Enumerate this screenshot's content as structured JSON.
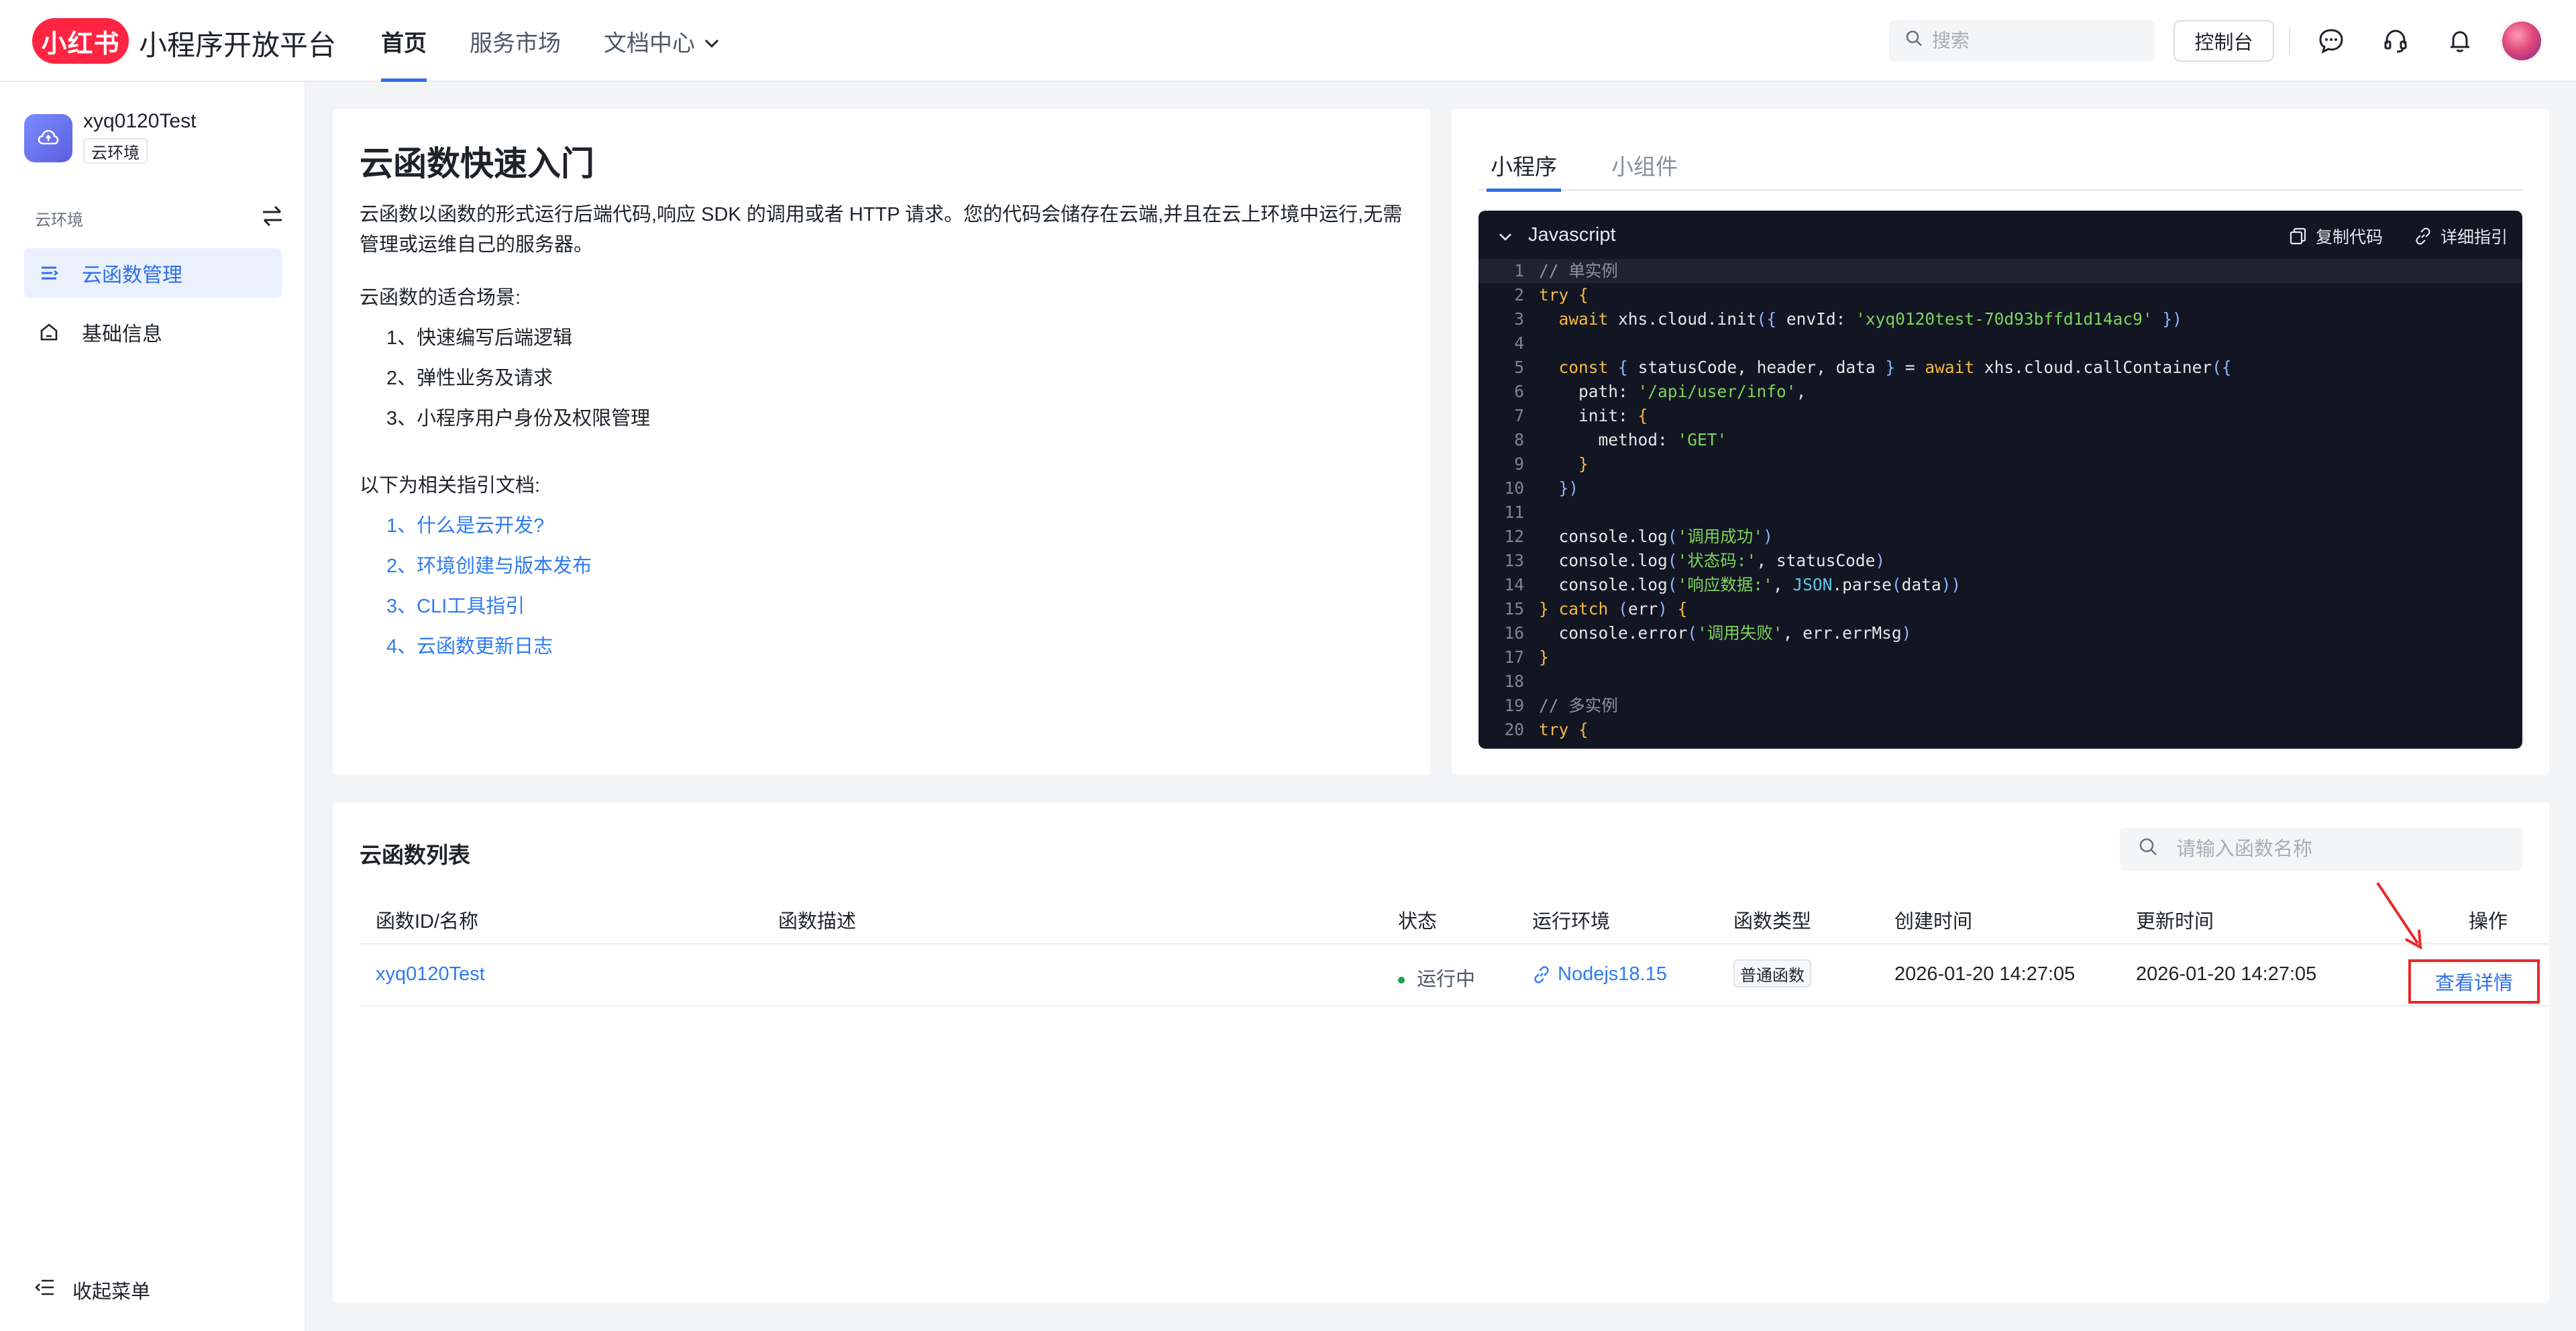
{
  "header": {
    "logo_text": "小红书",
    "brand": "小程序开放平台",
    "nav": [
      "首页",
      "服务市场",
      "文档中心"
    ],
    "search_placeholder": "搜索",
    "console_label": "控制台",
    "icons": [
      "message-icon",
      "headset-icon",
      "bell-icon",
      "avatar"
    ]
  },
  "sidebar": {
    "app_name": "xyq0120Test",
    "env_tag": "云环境",
    "section_label": "云环境",
    "items": [
      {
        "label": "云函数管理",
        "icon": "list-icon",
        "active": true
      },
      {
        "label": "基础信息",
        "icon": "home-icon",
        "active": false
      }
    ],
    "collapse_label": "收起菜单"
  },
  "intro": {
    "title": "云函数快速入门",
    "description": "云函数以函数的形式运行后端代码,响应 SDK 的调用或者 HTTP 请求。您的代码会储存在云端,并且在云上环境中运行,无需管理或运维自己的服务器。",
    "scenario_title": "云函数的适合场景:",
    "scenarios": [
      "1、快速编写后端逻辑",
      "2、弹性业务及请求",
      "3、小程序用户身份及权限管理"
    ],
    "docs_title": "以下为相关指引文档:",
    "docs": [
      "1、什么是云开发?",
      "2、环境创建与版本发布",
      "3、CLI工具指引",
      "4、云函数更新日志"
    ]
  },
  "code": {
    "tabs": [
      "小程序",
      "小组件"
    ],
    "active_tab": "小程序",
    "language": "Javascript",
    "copy_label": "复制代码",
    "guide_label": "详细指引",
    "env_id": "xyq0120test-70d93bffd1d14ac9",
    "path": "/api/user/info",
    "method": "GET",
    "msg_success": "调用成功",
    "msg_status": "状态码:",
    "msg_data": "响应数据:",
    "msg_fail": "调用失败",
    "comment_single": "// 单实例",
    "comment_multi": "// 多实例",
    "line_numbers": [
      "1",
      "2",
      "3",
      "4",
      "5",
      "6",
      "7",
      "8",
      "9",
      "10",
      "11",
      "12",
      "13",
      "14",
      "15",
      "16",
      "17",
      "18",
      "19",
      "20"
    ]
  },
  "list": {
    "title": "云函数列表",
    "search_placeholder": "请输入函数名称",
    "columns": [
      "函数ID/名称",
      "函数描述",
      "状态",
      "运行环境",
      "函数类型",
      "创建时间",
      "更新时间",
      "操作"
    ],
    "rows": [
      {
        "name": "xyq0120Test",
        "description": "",
        "status": "运行中",
        "runtime": "Nodejs18.15",
        "type": "普通函数",
        "created": "2026-01-20 14:27:05",
        "updated": "2026-01-20 14:27:05",
        "action": "查看详情"
      }
    ]
  },
  "colors": {
    "brand_red": "#ff2442",
    "accent_blue": "#2f6fe8",
    "status_green": "#1aa34a",
    "annotation_red": "#e52a2a",
    "code_bg": "#121522"
  }
}
